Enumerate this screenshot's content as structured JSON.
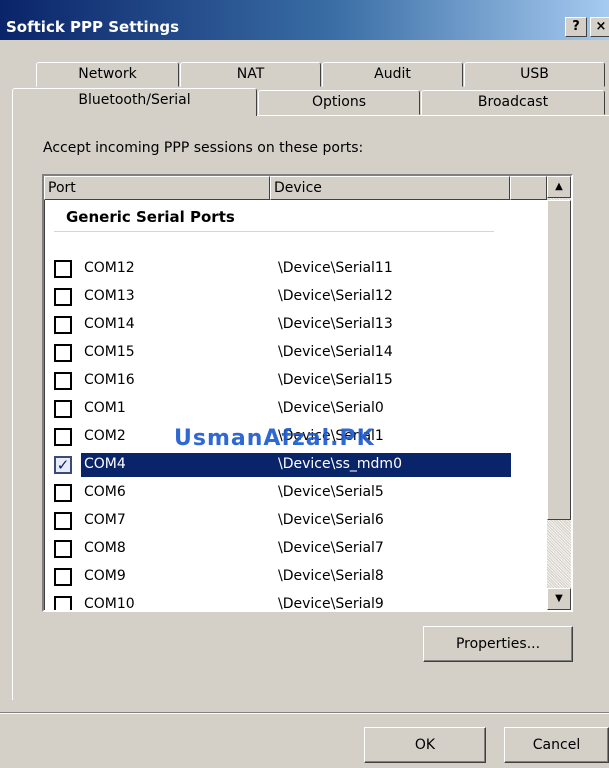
{
  "window": {
    "title": "Softick PPP Settings",
    "help_glyph": "?",
    "close_glyph": "×"
  },
  "tabs": {
    "row1": [
      "Network",
      "NAT",
      "Audit",
      "USB"
    ],
    "row2": [
      "Bluetooth/Serial",
      "Options",
      "Broadcast"
    ],
    "active": "Bluetooth/Serial"
  },
  "panel": {
    "accept_label": "Accept incoming PPP sessions on these ports:"
  },
  "listview": {
    "columns": [
      "Port",
      "Device",
      ""
    ],
    "group": "Generic Serial Ports",
    "rows": [
      {
        "port": "COM12",
        "device": "\\Device\\Serial11",
        "checked": false,
        "mark": ""
      },
      {
        "port": "COM13",
        "device": "\\Device\\Serial12",
        "checked": false,
        "mark": ""
      },
      {
        "port": "COM14",
        "device": "\\Device\\Serial13",
        "checked": false,
        "mark": ""
      },
      {
        "port": "COM15",
        "device": "\\Device\\Serial14",
        "checked": false,
        "mark": ""
      },
      {
        "port": "COM16",
        "device": "\\Device\\Serial15",
        "checked": false,
        "mark": ""
      },
      {
        "port": "COM1",
        "device": "\\Device\\Serial0",
        "checked": false,
        "mark": ""
      },
      {
        "port": "COM2",
        "device": "\\Device\\Serial1",
        "checked": false,
        "mark": ""
      },
      {
        "port": "COM4",
        "device": "\\Device\\ss_mdm0",
        "checked": true,
        "mark": "✓"
      },
      {
        "port": "COM6",
        "device": "\\Device\\Serial5",
        "checked": false,
        "mark": ""
      },
      {
        "port": "COM7",
        "device": "\\Device\\Serial6",
        "checked": false,
        "mark": ""
      },
      {
        "port": "COM8",
        "device": "\\Device\\Serial7",
        "checked": false,
        "mark": ""
      },
      {
        "port": "COM9",
        "device": "\\Device\\Serial8",
        "checked": false,
        "mark": ""
      },
      {
        "port": "COM10",
        "device": "\\Device\\Serial9",
        "checked": false,
        "mark": ""
      }
    ],
    "selected_port": "COM4",
    "scroll": {
      "up_glyph": "▲",
      "down_glyph": "▼"
    }
  },
  "watermark": "UsmanAfzal.PK",
  "buttons": {
    "properties": "Properties...",
    "ok": "OK",
    "cancel": "Cancel"
  }
}
